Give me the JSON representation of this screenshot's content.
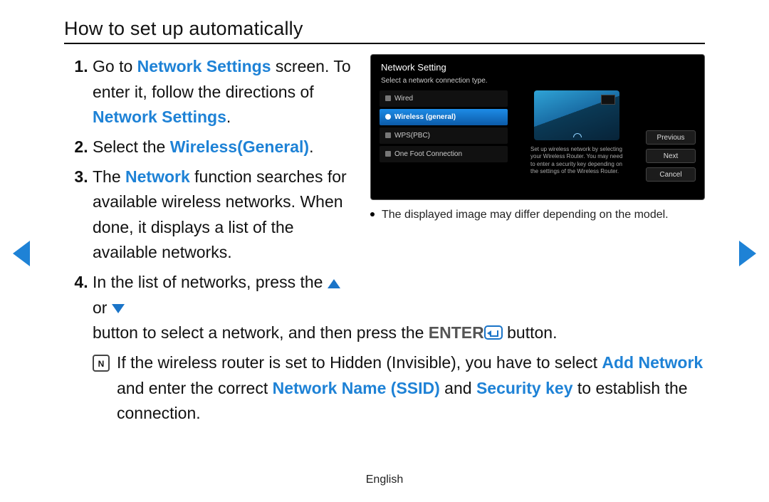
{
  "title": "How to set up automatically",
  "steps": {
    "s1_a": "Go to ",
    "s1_b": "Network Settings",
    "s1_c": " screen. To enter it, follow the directions of ",
    "s1_d": "Network Settings",
    "s1_e": ".",
    "s2_a": "Select the ",
    "s2_b": "Wireless(General)",
    "s2_c": ".",
    "s3_a": "The ",
    "s3_b": "Network",
    "s3_c": " function searches for available wireless networks. When done, it displays a list of the available networks.",
    "s4_a": "In the list of networks, press the ",
    "s4_b": " or ",
    "s4_c": " button to select a network, and then press the ",
    "s4_enter": "ENTER",
    "s4_d": " button."
  },
  "note": {
    "icon": "N",
    "a": "If the wireless router is set to Hidden (Invisible), you have to select ",
    "b": "Add Network",
    "c": " and enter the correct ",
    "d": "Network Name (SSID)",
    "e": " and ",
    "f": "Security key",
    "g": " to establish the connection."
  },
  "tv": {
    "title": "Network Setting",
    "subtitle": "Select a network connection type.",
    "items": [
      "Wired",
      "Wireless (general)",
      "WPS(PBC)",
      "One Foot Connection"
    ],
    "desc": "Set up wireless network by selecting your Wireless Router. You may need to enter a security key depending on the settings of the Wireless Router.",
    "buttons": [
      "Previous",
      "Next",
      "Cancel"
    ]
  },
  "caption": "The displayed image may differ depending on the model.",
  "footer": "English"
}
